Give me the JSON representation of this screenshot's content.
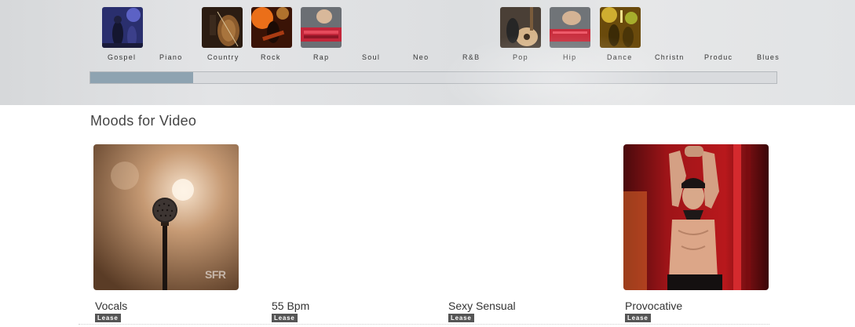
{
  "genres": [
    {
      "label": "Gospel",
      "icon": "gospel-concert-photo"
    },
    {
      "label": "Piano",
      "icon": null
    },
    {
      "label": "Country",
      "icon": "cello-player-photo"
    },
    {
      "label": "Rock",
      "icon": "rock-guitarist-photo"
    },
    {
      "label": "Rap",
      "icon": "beat-machine-photo"
    },
    {
      "label": "Soul",
      "icon": null
    },
    {
      "label": "Neo",
      "icon": null
    },
    {
      "label": "R&B",
      "icon": null
    },
    {
      "label": "Pop",
      "icon": "acoustic-guitar-photo"
    },
    {
      "label": "Hip",
      "icon": "beat-pads-photo"
    },
    {
      "label": "Dance",
      "icon": "dance-crowd-photo"
    },
    {
      "label": "Christn",
      "icon": null
    },
    {
      "label": "Produc",
      "icon": null
    },
    {
      "label": "Blues",
      "icon": null
    }
  ],
  "scrollbar": {
    "position_fraction": 0.0,
    "visible_fraction": 0.15
  },
  "section": {
    "title": "Moods for Video"
  },
  "videos": [
    {
      "title": "Vocals",
      "badge": "Lease",
      "thumbnail": "microphone-photo",
      "watermark": "SFR"
    },
    {
      "title": "55 Bpm",
      "badge": "Lease",
      "thumbnail": null
    },
    {
      "title": "Sexy Sensual",
      "badge": "Lease",
      "thumbnail": null
    },
    {
      "title": "Provocative",
      "badge": "Lease",
      "thumbnail": "dancer-photo"
    }
  ],
  "colors": {
    "header_bg": "#dcdee0",
    "scroll_thumb": "#8ea3b1",
    "badge_bg": "#555555"
  }
}
